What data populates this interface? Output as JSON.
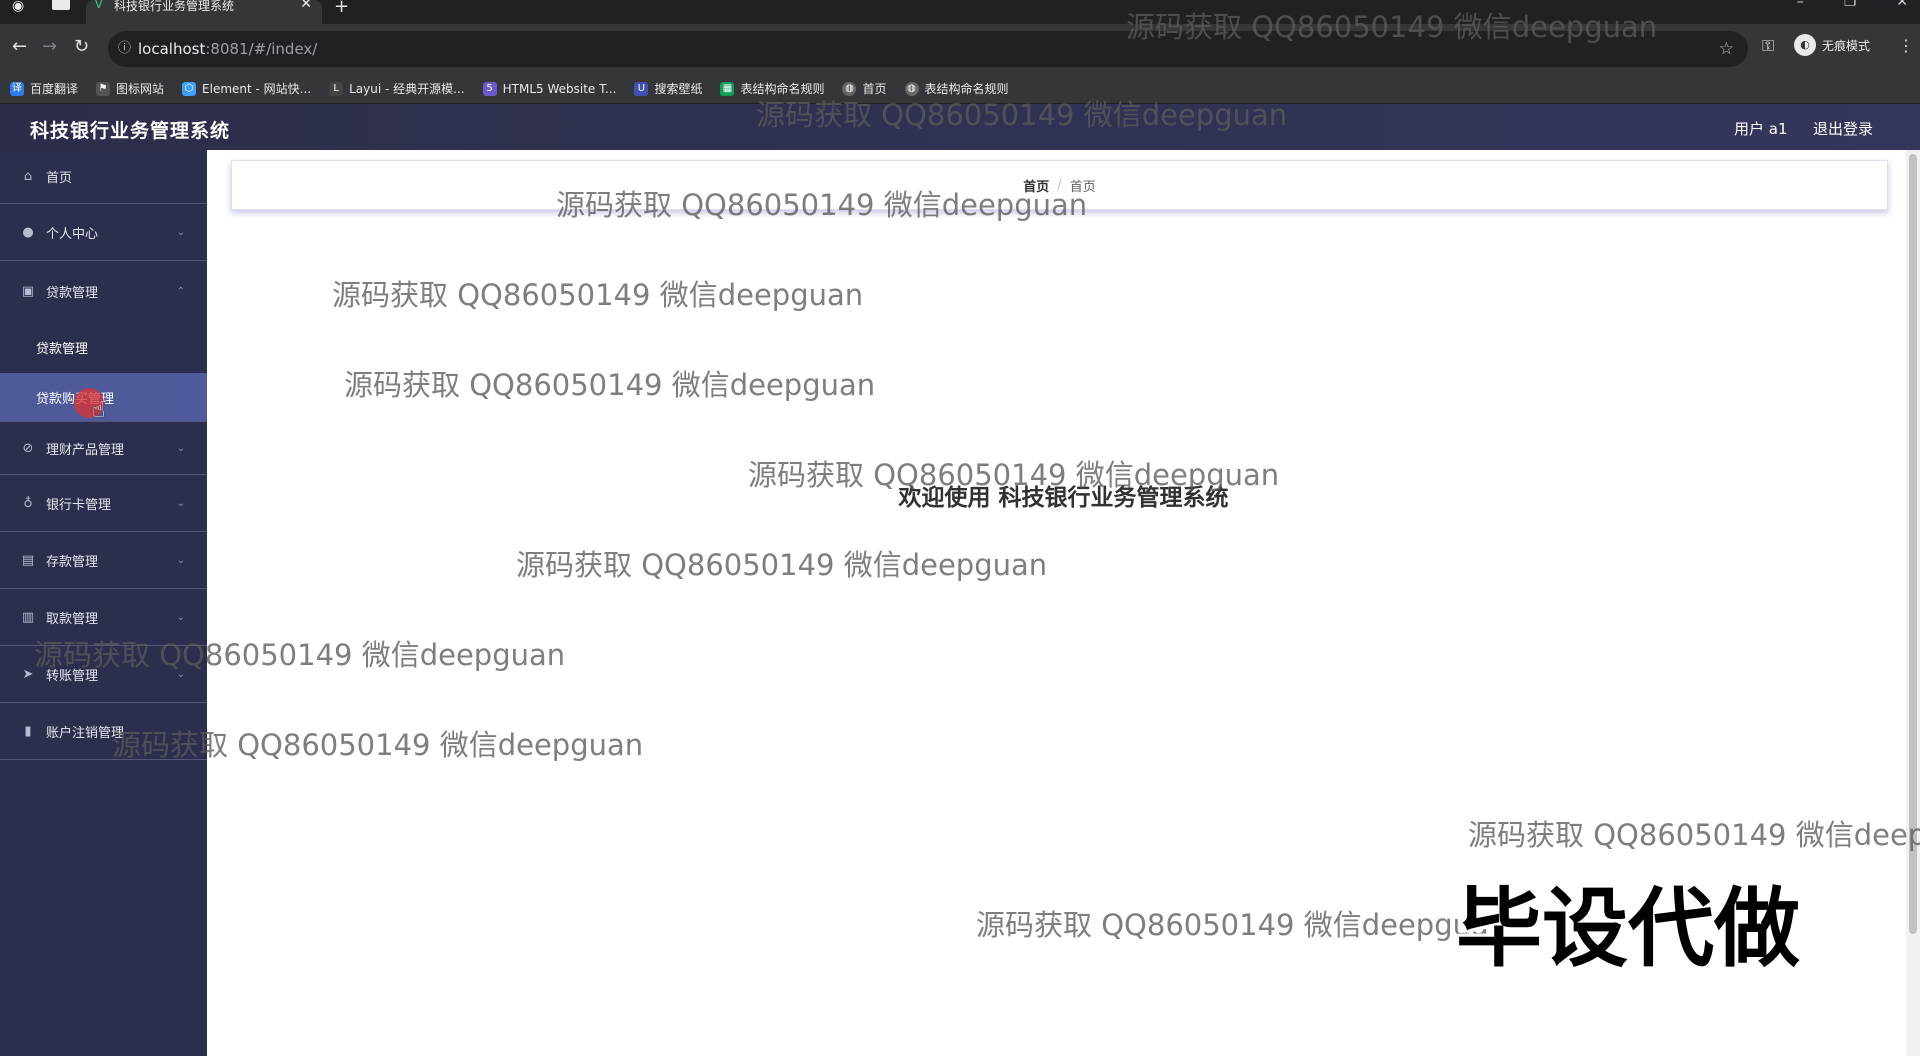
{
  "browser": {
    "tab_title": "科技银行业务管理系统",
    "url_host": "localhost",
    "url_path": ":8081/#/index/",
    "incognito_label": "无痕模式",
    "bookmarks": [
      "百度翻译",
      "图标网站",
      "Element - 网站快...",
      "Layui - 经典开源模...",
      "HTML5 Website T...",
      "搜索壁纸",
      "表结构命名规则",
      "首页",
      "表结构命名规则"
    ]
  },
  "header": {
    "title": "科技银行业务管理系统",
    "user": "用户 a1",
    "logout": "退出登录"
  },
  "sidebar": {
    "items": [
      {
        "label": "首页",
        "icon": "home-icon"
      },
      {
        "label": "个人中心",
        "icon": "user-icon"
      },
      {
        "label": "贷款管理",
        "icon": "loan-icon"
      },
      {
        "label": "理财产品管理",
        "icon": "finance-icon"
      },
      {
        "label": "银行卡管理",
        "icon": "card-icon"
      },
      {
        "label": "存款管理",
        "icon": "deposit-icon"
      },
      {
        "label": "取款管理",
        "icon": "withdraw-icon"
      },
      {
        "label": "转账管理",
        "icon": "transfer-icon"
      },
      {
        "label": "账户注销管理",
        "icon": "account-close-icon"
      }
    ],
    "sub_items": [
      {
        "label": "贷款管理"
      },
      {
        "label": "贷款购买管理"
      }
    ]
  },
  "breadcrumb": {
    "first": "首页",
    "separator": "/",
    "second": "首页"
  },
  "welcome": "欢迎使用 科技银行业务管理系统",
  "watermark": "源码获取 QQ86050149 微信deepguan",
  "overlay_big_text": "毕设代做",
  "colors": {
    "header_bg": "#2b2d4a",
    "sidebar_bg": "#2c2e4d",
    "active_sub": "#4f5a9b"
  }
}
